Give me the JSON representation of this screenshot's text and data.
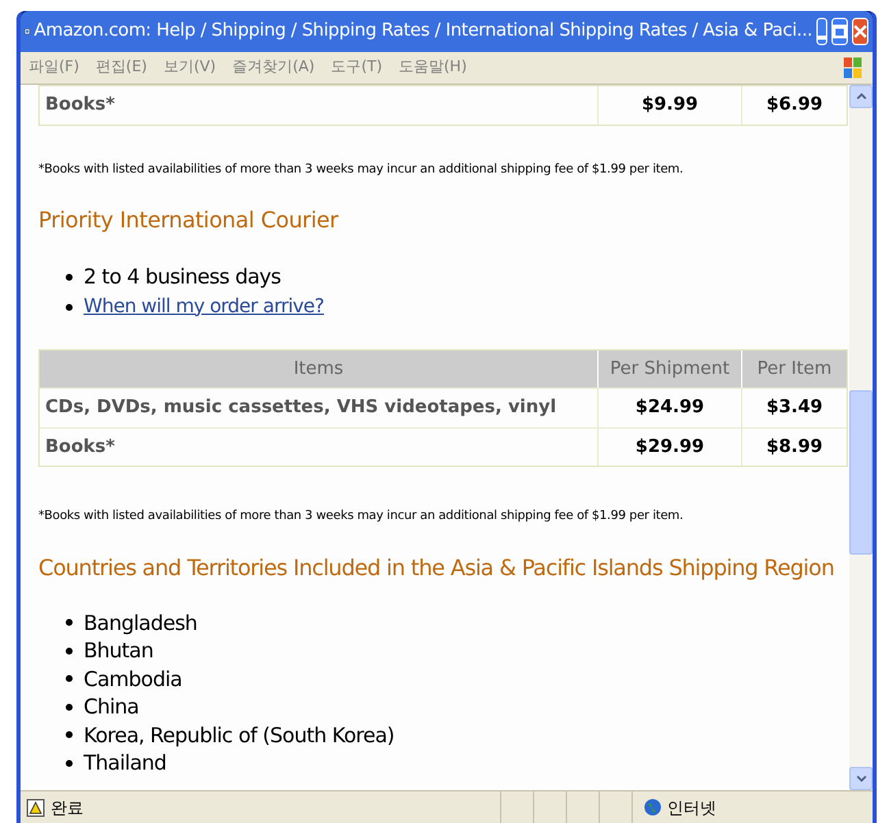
{
  "window": {
    "title": "Amazon.com: Help / Shipping / Shipping Rates / International Shipping Rates / Asia & Paci..."
  },
  "menu": [
    "파일(F)",
    "편집(E)",
    "보기(V)",
    "즐겨찾기(A)",
    "도구(T)",
    "도움말(H)"
  ],
  "top_table": {
    "rows": [
      [
        "Books*",
        "$9.99",
        "$6.99"
      ]
    ]
  },
  "footnote_1": "*Books with listed availabilities of more than 3 weeks may incur an additional shipping fee of $1.99 per item.",
  "section_heading": "Priority International Courier",
  "bullets": [
    {
      "kind": "text",
      "text": "2 to 4 business days"
    },
    {
      "kind": "link",
      "text": "When will my order arrive?"
    }
  ],
  "table": {
    "columns": [
      "Items",
      "Per Shipment",
      "Per Item"
    ],
    "rows": [
      [
        "CDs, DVDs, music cassettes, VHS videotapes, vinyl",
        "$24.99",
        "$3.49"
      ],
      [
        "Books*",
        "$29.99",
        "$8.99"
      ]
    ]
  },
  "footnote_2": "*Books with listed availabilities of more than 3 weeks may incur an additional shipping fee of $1.99 per item.",
  "countries_heading": "Countries and Territories Included in the Asia & Pacific Islands Shipping Region",
  "countries": [
    "Bangladesh",
    "Bhutan",
    "Cambodia",
    "China",
    "Korea, Republic of (South Korea)",
    "Thailand"
  ],
  "status_bar": {
    "status": "완료",
    "zone": "인터넷"
  }
}
